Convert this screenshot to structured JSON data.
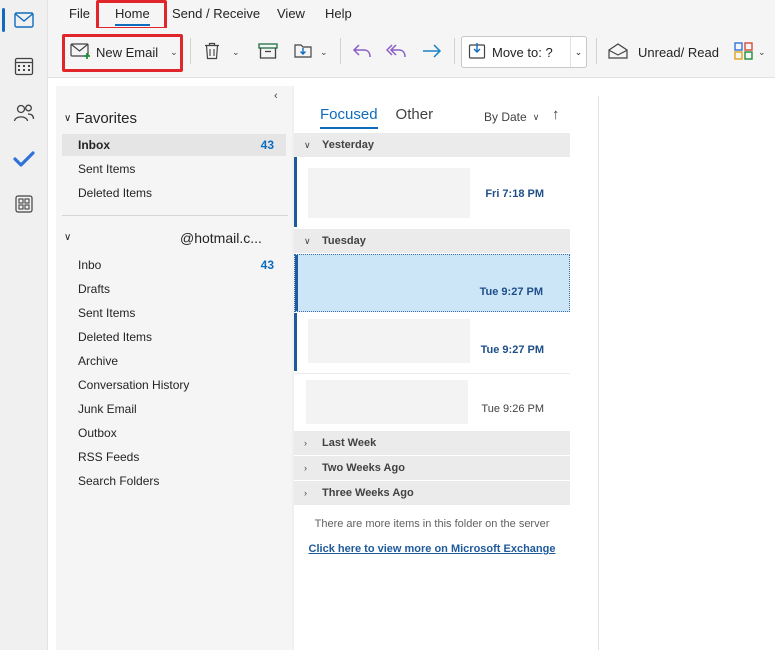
{
  "menu": {
    "items": [
      "File",
      "Home",
      "Send / Receive",
      "View",
      "Help"
    ]
  },
  "ribbon": {
    "new_email": "New Email",
    "move_to": "Move to: ?",
    "unread_read": "Unread/ Read"
  },
  "folders": {
    "favorites_label": "Favorites",
    "favorites": [
      {
        "name": "Inbox",
        "count": "43"
      },
      {
        "name": "Sent Items",
        "count": ""
      },
      {
        "name": "Deleted Items",
        "count": ""
      }
    ],
    "account_label": "@hotmail.c...",
    "account": [
      {
        "name": "Inbo",
        "count": "43"
      },
      {
        "name": "Drafts",
        "count": ""
      },
      {
        "name": "Sent Items",
        "count": ""
      },
      {
        "name": "Deleted Items",
        "count": ""
      },
      {
        "name": "Archive",
        "count": ""
      },
      {
        "name": "Conversation History",
        "count": ""
      },
      {
        "name": "Junk Email",
        "count": ""
      },
      {
        "name": "Outbox",
        "count": ""
      },
      {
        "name": "RSS Feeds",
        "count": ""
      },
      {
        "name": "Search Folders",
        "count": ""
      }
    ]
  },
  "list": {
    "tab_focused": "Focused",
    "tab_other": "Other",
    "sort_label": "By Date",
    "sections": {
      "yesterday": "Yesterday",
      "tuesday": "Tuesday",
      "last_week": "Last Week",
      "two_weeks": "Two Weeks Ago",
      "three_weeks": "Three Weeks Ago"
    },
    "messages": [
      {
        "time": "Fri 7:18 PM"
      },
      {
        "time": "Tue 9:27 PM"
      },
      {
        "time": "Tue 9:27 PM"
      },
      {
        "time": "Tue 9:26 PM"
      }
    ],
    "more_items": "There are more items in this folder on the server",
    "view_more_link": "Click here to view more on Microsoft Exchange"
  },
  "colors": {
    "accent": "#0f6cbd",
    "highlight": "#e0262b",
    "selected_message": "#cde6f7"
  }
}
